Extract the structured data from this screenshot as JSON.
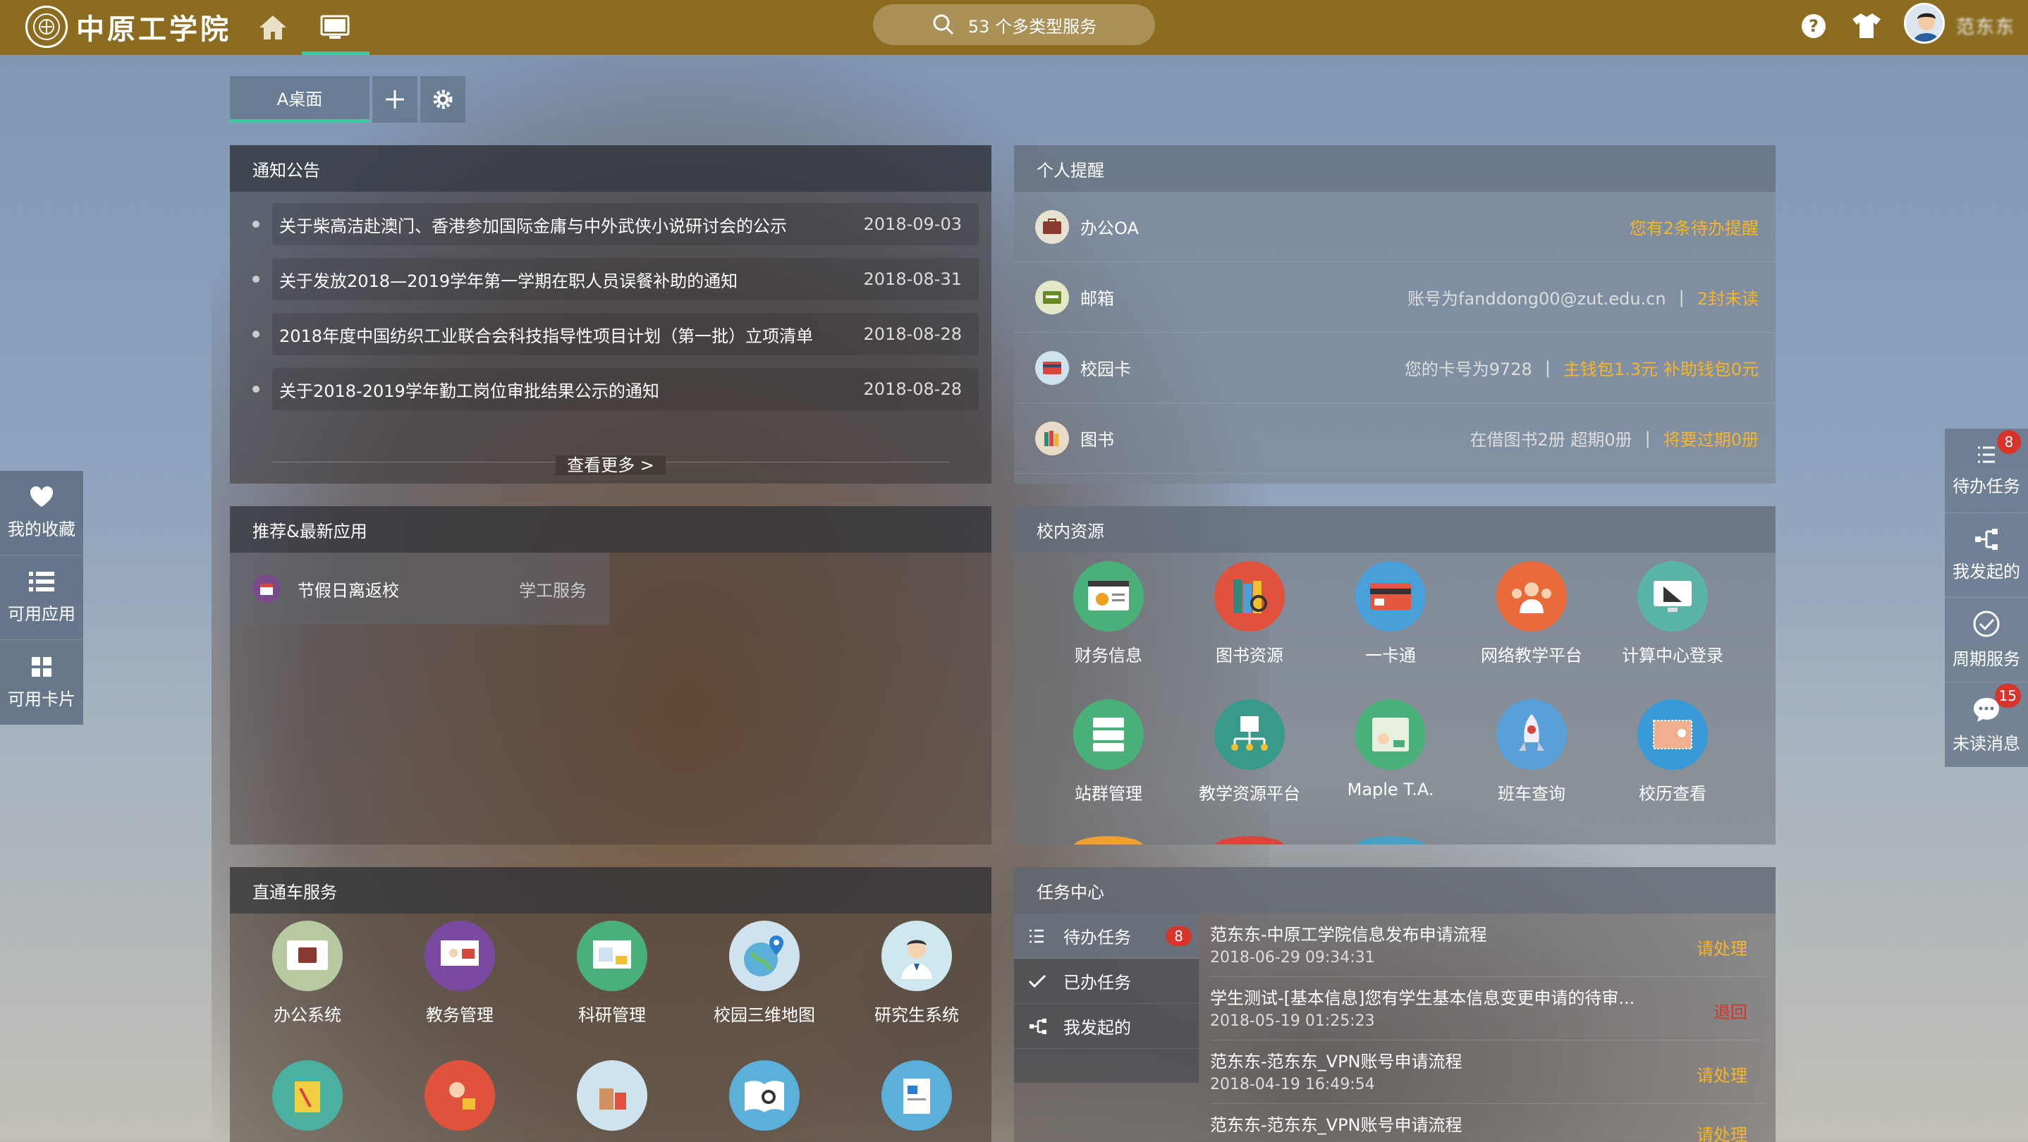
{
  "topbar": {
    "logo_text": "中原工学院",
    "search_text": "53 个多类型服务",
    "username": "范东东"
  },
  "desktop_tabs": {
    "active": "A桌面"
  },
  "notice": {
    "title": "通知公告",
    "items": [
      {
        "text": "关于柴高洁赴澳门、香港参加国际金庸与中外武侠小说研讨会的公示",
        "date": "2018-09-03"
      },
      {
        "text": "关于发放2018—2019学年第一学期在职人员误餐补助的通知",
        "date": "2018-08-31"
      },
      {
        "text": "2018年度中国纺织工业联合会科技指导性项目计划（第一批）立项清单",
        "date": "2018-08-28"
      },
      {
        "text": "关于2018-2019学年勤工岗位审批结果公示的通知",
        "date": "2018-08-28"
      }
    ],
    "more": "查看更多 >"
  },
  "reminders": {
    "title": "个人提醒",
    "oa": {
      "label": "办公OA",
      "alert": "您有2条待办提醒"
    },
    "mail": {
      "label": "邮箱",
      "info": "账号为fanddong00@zut.edu.cn",
      "sep": "|",
      "alert": "2封未读"
    },
    "card": {
      "label": "校园卡",
      "info": "您的卡号为9728",
      "sep": "|",
      "alert": "主钱包1.3元 补助钱包0元"
    },
    "books": {
      "label": "图书",
      "info": "在借图书2册 超期0册",
      "sep": "|",
      "alert": "将要过期0册"
    }
  },
  "recommend": {
    "title": "推荐&最新应用",
    "app_name": "节假日离返校",
    "app_tag": "学工服务"
  },
  "campus": {
    "title": "校内资源",
    "items": [
      "财务信息",
      "图书资源",
      "一卡通",
      "网络教学平台",
      "计算中心登录",
      "站群管理",
      "教学资源平台",
      "Maple T.A.",
      "班车查询",
      "校历查看"
    ]
  },
  "express": {
    "title": "直通车服务",
    "items": [
      "办公系统",
      "教务管理",
      "科研管理",
      "校园三维地图",
      "研究生系统"
    ]
  },
  "tasks": {
    "title": "任务中心",
    "menu": [
      {
        "label": "待办任务",
        "badge": "8"
      },
      {
        "label": "已办任务"
      },
      {
        "label": "我发起的"
      }
    ],
    "rows": [
      {
        "title": "范东东-中原工学院信息发布申请流程",
        "time": "2018-06-29 09:34:31",
        "status": "请处理"
      },
      {
        "title": "学生测试-[基本信息]您有学生基本信息变更申请的待审...",
        "time": "2018-05-19 01:25:23",
        "status": "退回"
      },
      {
        "title": "范东东-范东东_VPN账号申请流程",
        "time": "2018-04-19 16:49:54",
        "status": "请处理"
      },
      {
        "title": "范东东-范东东_VPN账号申请流程",
        "time": "",
        "status": "请处理"
      }
    ]
  },
  "left_sidebar": [
    "我的收藏",
    "可用应用",
    "可用卡片"
  ],
  "right_sidebar": [
    {
      "label": "待办任务",
      "badge": "8"
    },
    {
      "label": "我发起的"
    },
    {
      "label": "周期服务"
    },
    {
      "label": "未读消息",
      "badge": "15"
    }
  ],
  "colors": {
    "topbar": "#8c6c20",
    "accent": "#3fc7a0",
    "alert": "#f6b52a",
    "badge": "#d9342b"
  }
}
